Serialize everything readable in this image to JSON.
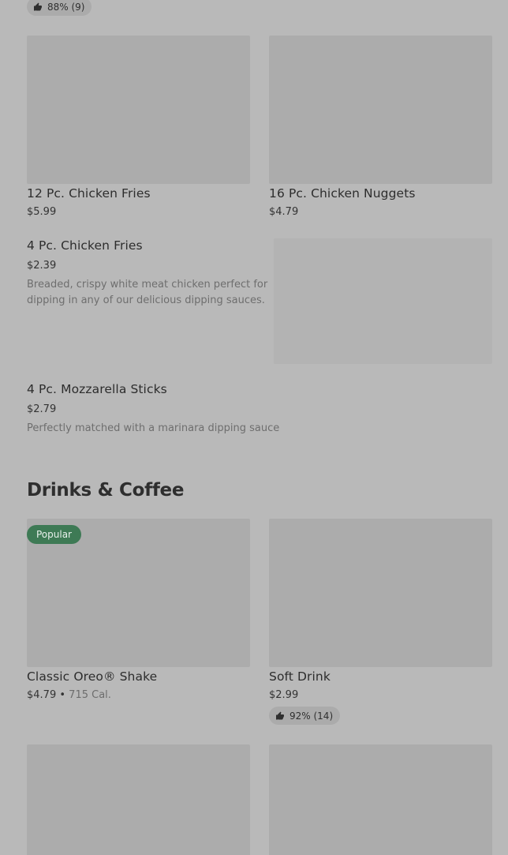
{
  "top_rating": {
    "text": "88% (9)",
    "icon": "thumbs-up-icon"
  },
  "items": {
    "chicken_fries_12": {
      "name": "12 Pc. Chicken Fries",
      "price": "$5.99"
    },
    "nuggets_16": {
      "name": "16 Pc. Chicken Nuggets",
      "price": "$4.79"
    },
    "chicken_fries_4": {
      "name": "4 Pc. Chicken Fries",
      "price": "$2.39",
      "description": "Breaded, crispy white meat chicken perfect for dipping in any of our delicious dipping sauces."
    },
    "mozzarella_sticks_4": {
      "name": "4 Pc. Mozzarella Sticks",
      "price": "$2.79",
      "description": "Perfectly matched with a marinara dipping sauce"
    }
  },
  "drinks_section": {
    "title": "Drinks & Coffee",
    "items": {
      "oreo_shake": {
        "name": "Classic Oreo® Shake",
        "price": "$4.79",
        "separator": "•",
        "calories": "715 Cal.",
        "badge": "Popular"
      },
      "soft_drink": {
        "name": "Soft Drink",
        "price": "$2.99",
        "rating": "92% (14)"
      }
    }
  },
  "colors": {
    "background": "#b9b9b9",
    "placeholder": "#acacac",
    "badge": "#3e7a55"
  }
}
